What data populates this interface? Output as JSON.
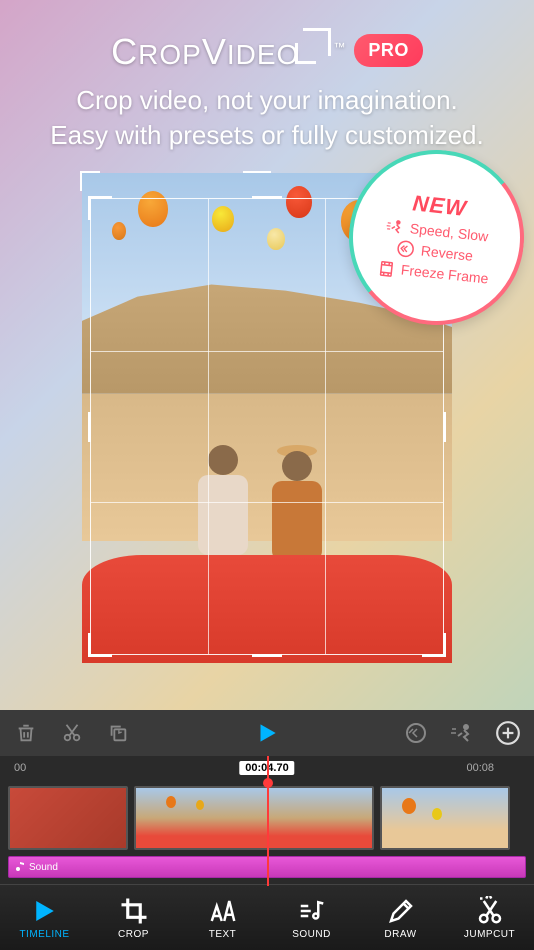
{
  "app": {
    "title": "CropVideo",
    "tm": "™",
    "badge": "PRO"
  },
  "tagline": {
    "line1": "Crop video, not your imagination.",
    "line2": "Easy with presets or fully customized."
  },
  "new_badge": {
    "title": "NEW",
    "features": [
      "Speed, Slow",
      "Reverse",
      "Freeze Frame"
    ]
  },
  "timeline": {
    "time_start": "00",
    "current_time": "00:04.70",
    "time_end": "00:08",
    "sound_label": "Sound"
  },
  "tabs": [
    {
      "label": "TIMELINE"
    },
    {
      "label": "CROP"
    },
    {
      "label": "TEXT"
    },
    {
      "label": "SOUND"
    },
    {
      "label": "DRAW"
    },
    {
      "label": "JUMPCUT"
    }
  ]
}
